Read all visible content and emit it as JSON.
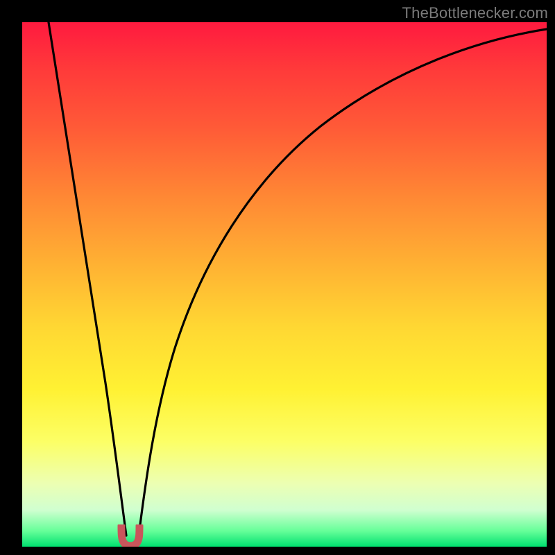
{
  "attribution": "TheBottlenecker.com",
  "colors": {
    "background": "#000000",
    "curve": "#000000",
    "cusp": "#c9555b",
    "gradient_top": "#ff1a3f",
    "gradient_bottom": "#00e070"
  },
  "chart_data": {
    "type": "line",
    "title": "",
    "xlabel": "",
    "ylabel": "",
    "xlim": [
      0,
      100
    ],
    "ylim": [
      0,
      100
    ],
    "series": [
      {
        "name": "bottleneck-curve",
        "x": [
          5,
          10,
          14,
          17,
          19,
          20.5,
          22,
          23.5,
          25,
          28,
          33,
          40,
          50,
          62,
          75,
          88,
          100
        ],
        "values": [
          100,
          79,
          57,
          38,
          20,
          6,
          2,
          6,
          17,
          33,
          50,
          64,
          76,
          85,
          91,
          95,
          98
        ]
      }
    ],
    "annotations": [
      {
        "name": "cusp-marker",
        "x": 20.5,
        "y": 2,
        "shape": "U",
        "color": "#c9555b"
      }
    ]
  }
}
